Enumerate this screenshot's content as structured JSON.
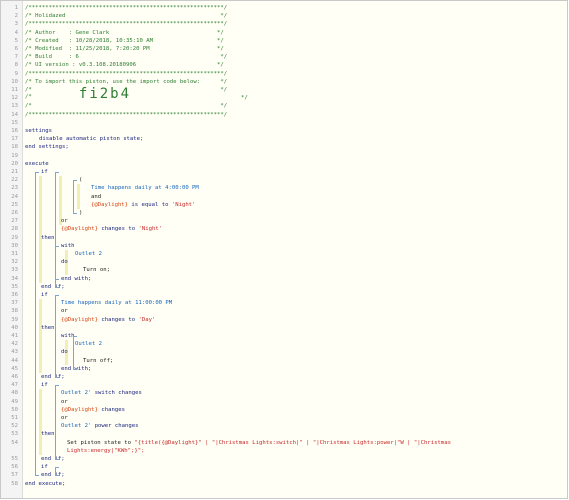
{
  "gutter": {
    "line_numbers": [
      "1",
      "2",
      "3",
      "4",
      "5",
      "6",
      "7",
      "8",
      "9",
      "10",
      "11",
      "12",
      "13",
      "14",
      "15",
      "16",
      "17",
      "18",
      "19",
      "20",
      "21",
      "22",
      "23",
      "24",
      "25",
      "26",
      "27",
      "28",
      "29",
      "30",
      "31",
      "32",
      "33",
      "34",
      "35",
      "36",
      "37",
      "38",
      "39",
      "40",
      "41",
      "42",
      "43",
      "44",
      "45",
      "46",
      "47",
      "48",
      "49",
      "50",
      "51",
      "52",
      "53",
      "54",
      "",
      "55",
      "56",
      "57",
      "58"
    ]
  },
  "header": {
    "border": "/**********************************************************/",
    "title": "/* Holidazed                                              */",
    "author": "/* Author    : Gene Clark                                */",
    "created": "/* Created   : 10/28/2018, 10:35:10 AM                   */",
    "modified": "/* Modified  : 11/25/2018, 7:20:20 PM                    */",
    "build": "/* Build     : 6                                          */",
    "ui_version": "/* UI version : v0.3.108.20180906                        */",
    "import_note": "/* To import this piston, use the import code below:      */",
    "blank": "/*                                                        */",
    "import_prefix": "/*              ",
    "import_code": "fi2b4",
    "import_suffix": "*/"
  },
  "code": {
    "settings": "settings",
    "disable_state": "disable automatic piston state;",
    "end_settings": "end settings;",
    "execute": "execute",
    "if": "if",
    "open_paren": "(",
    "close_paren": ")",
    "time_happens_daily_at": "Time happens daily at",
    "time1": "4:00:00 PM",
    "and": "and",
    "daylight": "{@Daylight}",
    "is_equal_to": "is equal to",
    "night": "'Night'",
    "or": "or",
    "changes_to": "changes to",
    "then": "then",
    "with": "with",
    "outlet2": "Outlet 2",
    "do": "do",
    "turn_on": "Turn on;",
    "end_with": "end with;",
    "end_if": "end if;",
    "time2": "11:00:00 PM",
    "day": "'Day'",
    "turn_off": "Turn off;",
    "outlet2_q": "Outlet 2'",
    "switch_changes": "switch changes",
    "changes": "changes",
    "power_changes": "power changes",
    "set_state": "Set piston state to",
    "set_state_expr": "\"{title({@Daylight}\" | \"|Christmas Lights:switch|\" | \"|Christmas Lights:power|\"W | \"|Christmas",
    "set_state_expr2": "Lights:energy|\"KWh\";}\";",
    "end_execute": "end execute;"
  }
}
